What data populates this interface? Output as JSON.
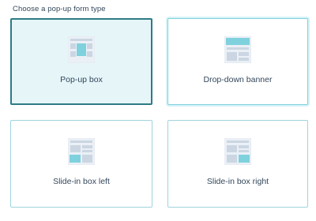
{
  "heading": "Choose a pop-up form type",
  "colors": {
    "accent": "#2e7b86",
    "selected_bg": "#e5f5f8",
    "card_border": "#9fd5dd",
    "thumb_bg": "#eaf0f6",
    "thumb_lines": "#cbd6e2",
    "thumb_highlight": "#7fd1de"
  },
  "options": [
    {
      "label": "Pop-up box",
      "icon": "popup-box-icon",
      "selected": true
    },
    {
      "label": "Drop-down banner",
      "icon": "dropdown-banner-icon",
      "selected": false
    },
    {
      "label": "Slide-in box left",
      "icon": "slide-in-left-icon",
      "selected": false
    },
    {
      "label": "Slide-in box right",
      "icon": "slide-in-right-icon",
      "selected": false
    }
  ]
}
